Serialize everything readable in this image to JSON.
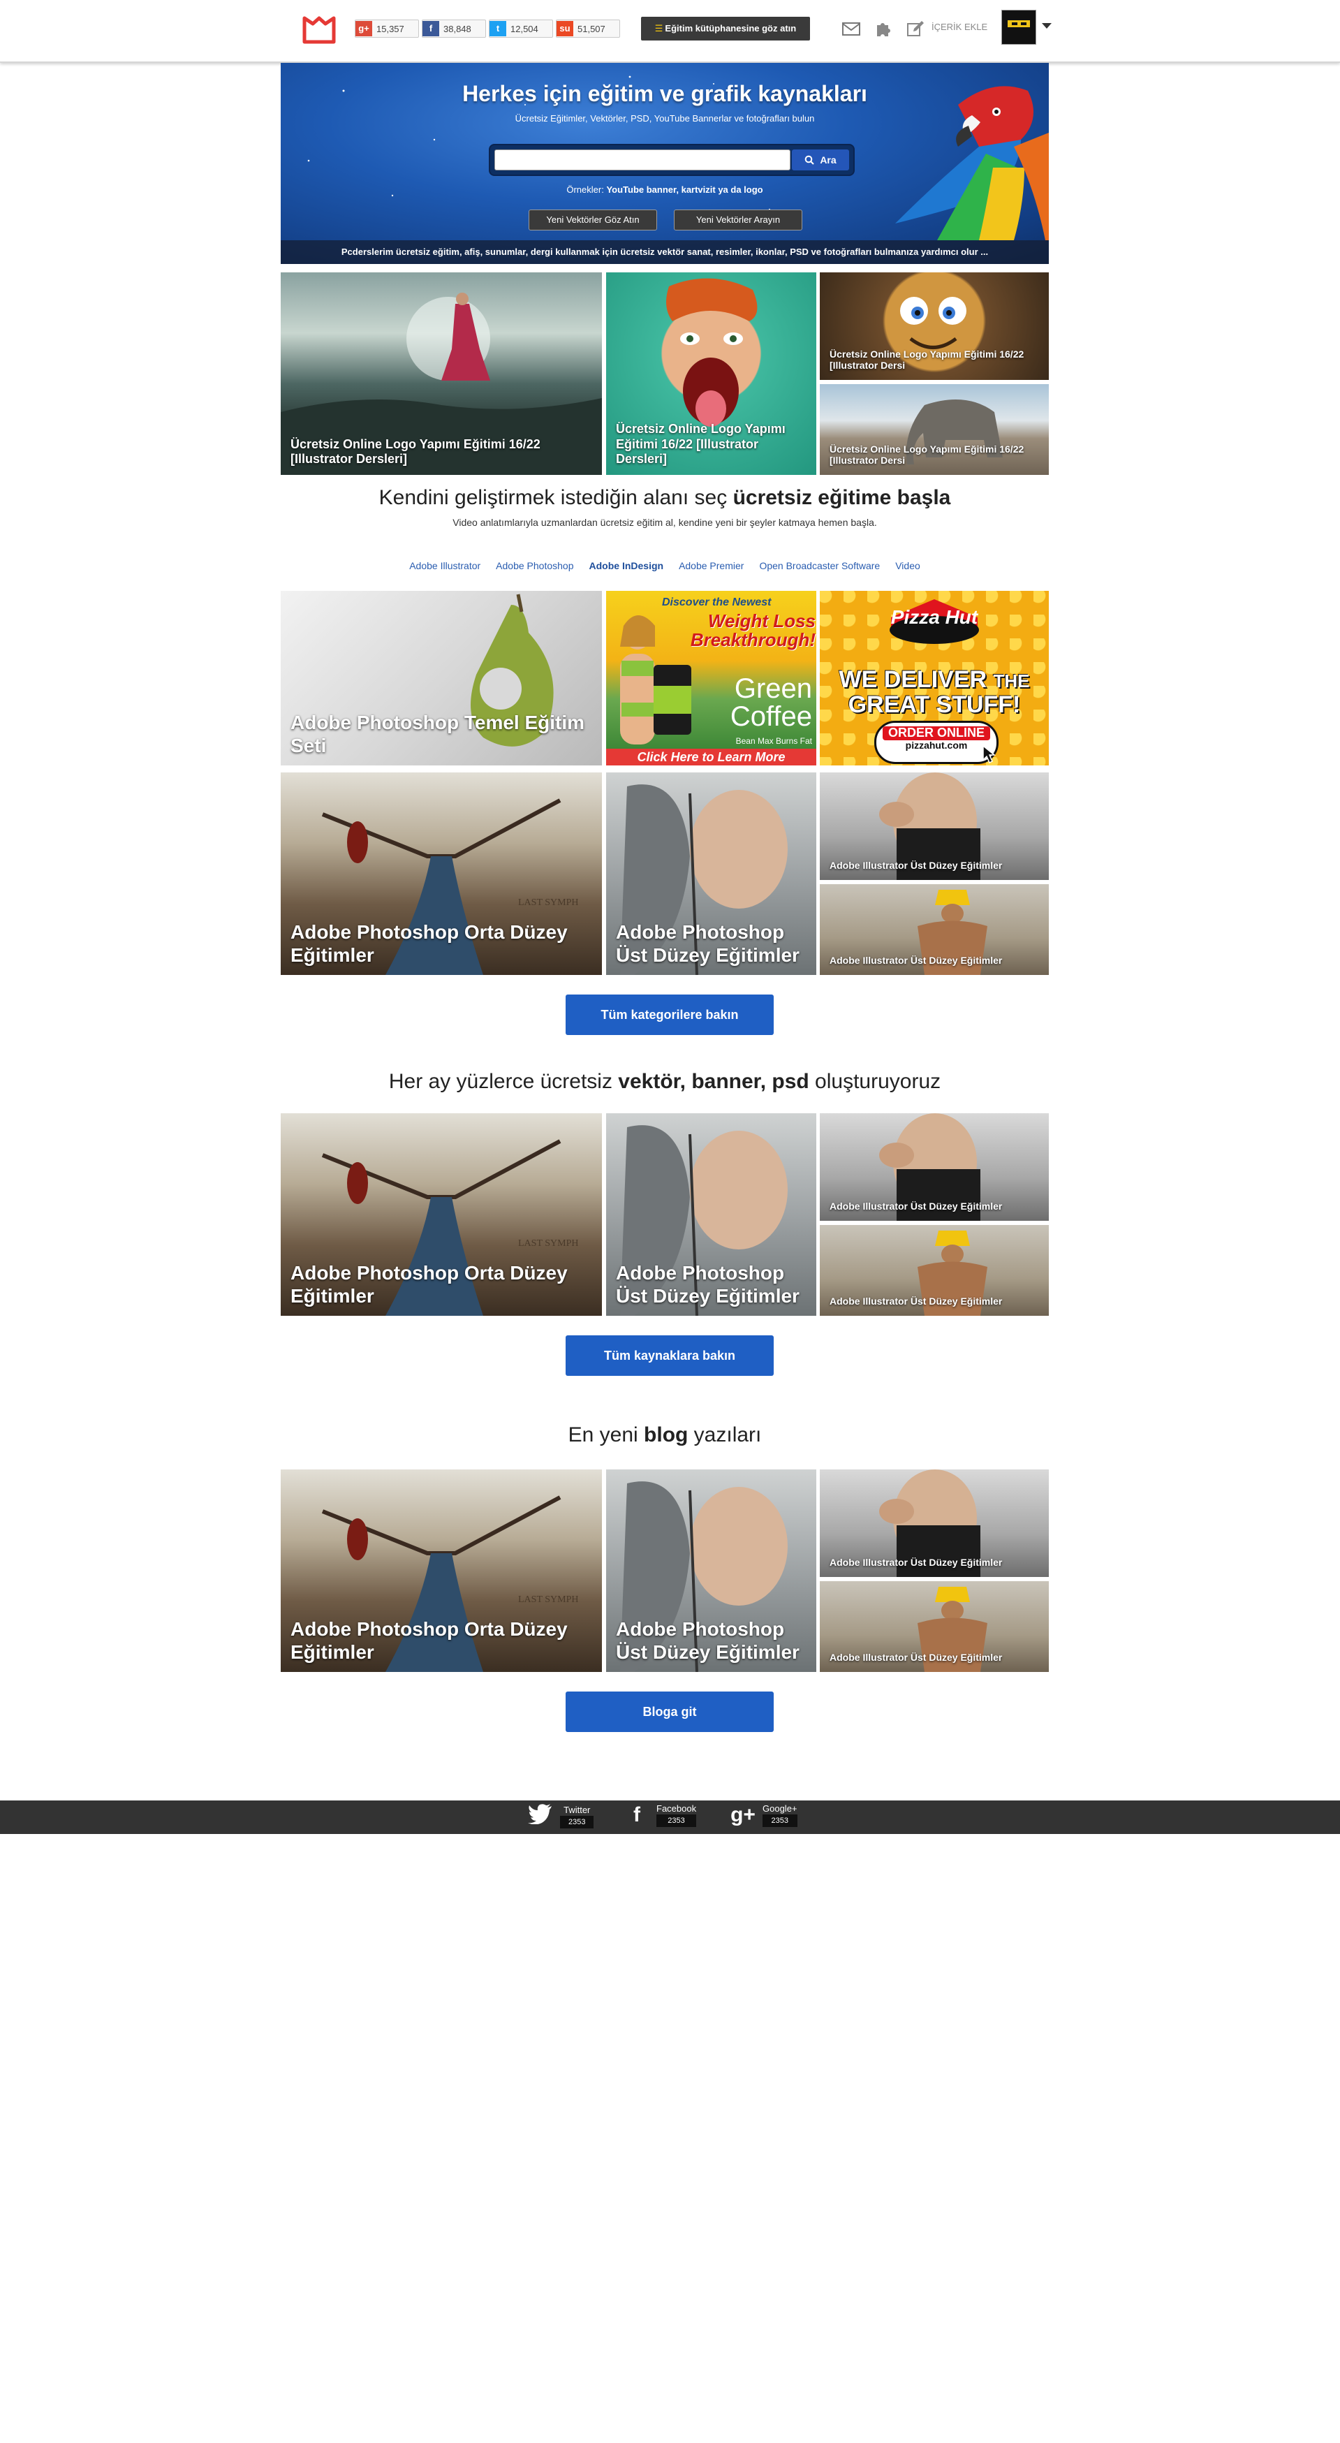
{
  "header": {
    "social_counts": [
      {
        "icon": "google-plus-icon",
        "count": "15,357",
        "color": "#dd4b39"
      },
      {
        "icon": "facebook-icon",
        "count": "38,848",
        "color": "#3b5998"
      },
      {
        "icon": "twitter-icon",
        "count": "12,504",
        "color": "#1da1f2"
      },
      {
        "icon": "stumbleupon-icon",
        "count": "51,507",
        "color": "#eb4924"
      }
    ],
    "library_button": "Eğitim kütüphanesine göz atın",
    "add_content": "İÇERİK EKLE"
  },
  "hero": {
    "title": "Herkes için eğitim ve grafik kaynakları",
    "subtitle": "Ücretsiz Eğitimler, Vektörler, PSD, YouTube Bannerlar ve fotoğrafları bulun",
    "search_placeholder": "",
    "search_button": "Ara",
    "examples_label": "Örnekler:",
    "examples_value": "YouTube banner, kartvizit ya da logo",
    "btn_new_vectors": "Yeni Vektörler Göz Atın",
    "btn_search_vectors": "Yeni Vektörler Arayın",
    "footer_text": "Pcderslerim ücretsiz eğitim, afiş, sunumlar, dergi kullanmak için ücretsiz vektör sanat, resimler, ikonlar, PSD ve fotoğrafları bulmanıza yardımcı olur ..."
  },
  "featured": [
    {
      "caption": "Ücretsiz Online Logo Yapımı Eğitimi 16/22 [Illustrator Dersleri]"
    },
    {
      "caption": "Ücretsiz Online Logo Yapımı Eğitimi 16/22 [Illustrator Dersleri]"
    },
    {
      "caption": "Ücretsiz Online Logo Yapımı Eğitimi 16/22 [Illustrator Dersi"
    },
    {
      "caption": "Ücretsiz Online Logo Yapımı Eğitimi 16/22 [Illustrator Dersi"
    }
  ],
  "categories_section": {
    "title_plain": "Kendini geliştirmek istediğin alanı seç ",
    "title_bold": "ücretsiz eğitime başla",
    "subtitle": "Video anlatımlarıyla uzmanlardan ücretsiz eğitim al, kendine yeni bir şeyler katmaya hemen başla.",
    "nav": [
      "Adobe Illustrator",
      "Adobe Photoshop",
      "Adobe InDesign",
      "Adobe Premier",
      "Open Broadcaster Software",
      "Video"
    ],
    "active_nav": "Adobe InDesign",
    "tiles": [
      "Adobe Photoshop Temel Eğitim Seti",
      "Adobe Photoshop Orta Düzey Eğitimler",
      "Adobe Photoshop Üst Düzey Eğitimler",
      "Adobe Illustrator Üst Düzey Eğitimler",
      "Adobe Illustrator Üst Düzey Eğitimler"
    ],
    "ad_coffee": {
      "top": "Discover the Newest",
      "headline": "Weight Loss Breakthrough!",
      "product": "Green Coffee",
      "tag": "Bean Max Burns Fat",
      "cta": "Click Here to Learn More"
    },
    "ad_pizza": {
      "brand": "Pizza Hut",
      "line1": "WE DELIVER",
      "line2": "THE",
      "line3": "GREAT STUFF!",
      "cta": "ORDER ONLINE",
      "url": "pizzahut.com"
    },
    "button": "Tüm kategorilere bakın"
  },
  "vectors_section": {
    "title_plain": "Her ay yüzlerce  ücretsiz ",
    "title_bold": "vektör, banner, psd",
    "title_end": " oluşturuyoruz",
    "tiles": [
      "Adobe Photoshop Orta Düzey Eğitimler",
      "Adobe Photoshop Üst Düzey Eğitimler",
      "Adobe Illustrator Üst Düzey Eğitimler",
      "Adobe Illustrator Üst Düzey Eğitimler"
    ],
    "button": "Tüm kaynaklara bakın"
  },
  "blog_section": {
    "title_plain": "En yeni ",
    "title_bold": "blog",
    "title_end": " yazıları",
    "tiles": [
      "Adobe Photoshop Orta Düzey Eğitimler",
      "Adobe Photoshop Üst Düzey Eğitimler",
      "Adobe Illustrator Üst Düzey Eğitimler",
      "Adobe Illustrator Üst Düzey Eğitimler"
    ],
    "button": "Bloga git"
  },
  "footer": {
    "social": [
      {
        "name": "Twitter",
        "count": "2353",
        "icon": "twitter-icon"
      },
      {
        "name": "Facebook",
        "count": "2353",
        "icon": "facebook-icon"
      },
      {
        "name": "Google+",
        "count": "2353",
        "icon": "google-plus-icon"
      }
    ]
  },
  "colors": {
    "brand_red": "#e53935",
    "accent_blue": "#1f5fc4",
    "footer_bg": "#333333"
  }
}
